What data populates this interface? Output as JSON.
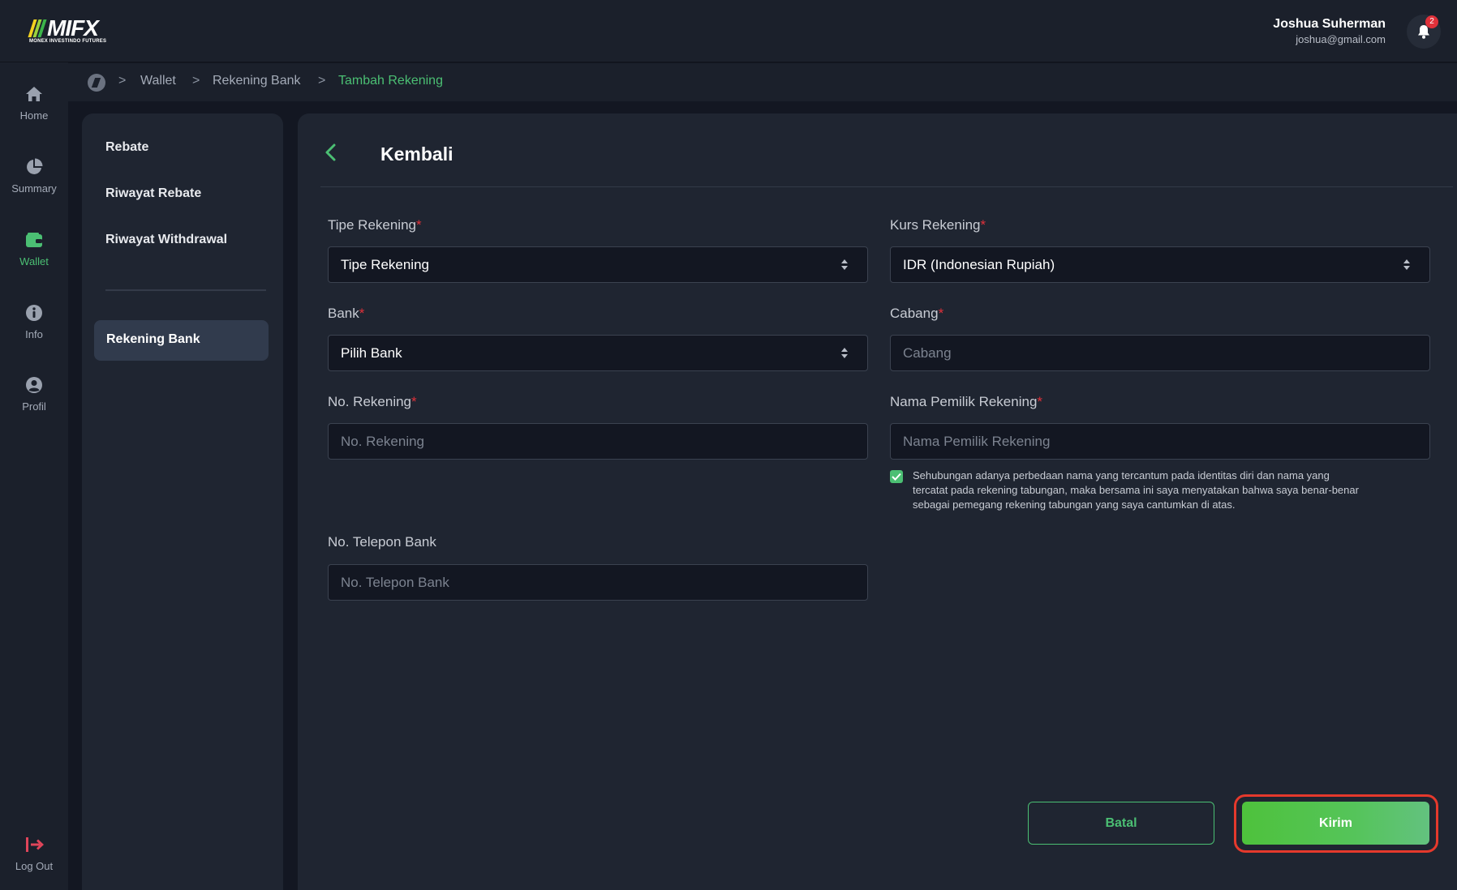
{
  "brand": {
    "logo_word": "MIFX",
    "logo_sub": "MONEX INVESTINDO FUTURES",
    "stripe_colors": [
      "#f4d21f",
      "#9bd23c",
      "#3cb54a"
    ]
  },
  "user": {
    "name": "Joshua Suherman",
    "email": "joshua@gmail.com",
    "notification_count": "2"
  },
  "nav": {
    "items": [
      {
        "label": "Home",
        "icon": "home-icon"
      },
      {
        "label": "Summary",
        "icon": "pie-chart-icon"
      },
      {
        "label": "Wallet",
        "icon": "wallet-icon",
        "active": true
      },
      {
        "label": "Info",
        "icon": "info-icon"
      },
      {
        "label": "Profil",
        "icon": "profile-icon"
      }
    ],
    "logout_label": "Log Out"
  },
  "breadcrumb": {
    "items": [
      "Wallet",
      "Rekening Bank",
      "Tambah Rekening"
    ],
    "separator": ">"
  },
  "submenu": {
    "items": [
      "Rebate",
      "Riwayat Rebate",
      "Riwayat Withdrawal"
    ],
    "active": "Rekening Bank"
  },
  "form": {
    "back_label": "Kembali",
    "required_mark": "*",
    "tipe_rekening": {
      "label": "Tipe Rekening",
      "value": "Tipe Rekening"
    },
    "kurs_rekening": {
      "label": "Kurs Rekening",
      "value": "IDR (Indonesian Rupiah)"
    },
    "bank": {
      "label": "Bank",
      "value": "Pilih Bank"
    },
    "cabang": {
      "label": "Cabang",
      "placeholder": "Cabang"
    },
    "no_rekening": {
      "label": "No. Rekening",
      "placeholder": "No. Rekening"
    },
    "nama_pemilik": {
      "label": "Nama Pemilik Rekening",
      "placeholder": "Nama Pemilik Rekening"
    },
    "no_telepon": {
      "label": "No. Telepon Bank",
      "placeholder": "No. Telepon Bank"
    },
    "consent_text": "Sehubungan adanya perbedaan nama yang tercantum pada identitas diri dan nama yang tercatat pada rekening tabungan, maka bersama ini saya menyatakan bahwa saya benar-benar sebagai pemegang rekening tabungan yang saya cantumkan di atas.",
    "consent_checked": true,
    "cancel_label": "Batal",
    "submit_label": "Kirim"
  },
  "colors": {
    "accent": "#4bbf73",
    "required": "#e0313a",
    "highlight": "#e5392c"
  }
}
